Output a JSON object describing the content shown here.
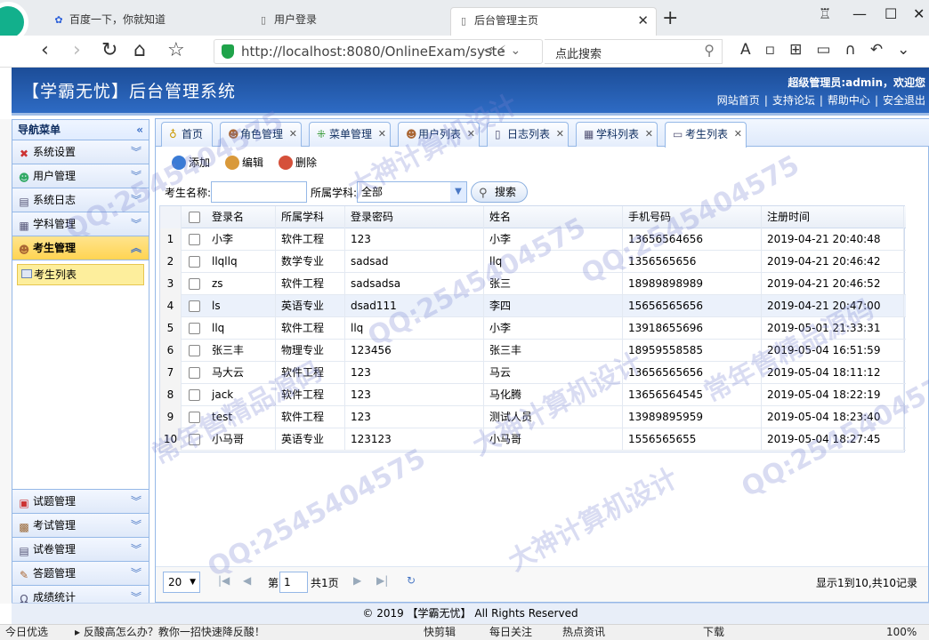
{
  "browser": {
    "tabs": [
      {
        "label": "百度一下，你就知道",
        "icon": "paw-icon"
      },
      {
        "label": "用户登录",
        "icon": "page-icon"
      },
      {
        "label": "后台管理主页",
        "icon": "page-icon",
        "active": true
      }
    ],
    "url": "http://localhost:8080/OnlineExam/syste",
    "search_placeholder": "点此搜索"
  },
  "header": {
    "title": "【学霸无忧】后台管理系统",
    "welcome": "超级管理员:admin，欢迎您",
    "links": [
      "网站首页",
      "支持论坛",
      "帮助中心",
      "安全退出"
    ]
  },
  "sidebar": {
    "title": "导航菜单",
    "items": [
      {
        "label": "系统设置",
        "icon": "tools-icon"
      },
      {
        "label": "用户管理",
        "icon": "users-icon"
      },
      {
        "label": "系统日志",
        "icon": "log-icon"
      },
      {
        "label": "学科管理",
        "icon": "list-icon"
      },
      {
        "label": "考生管理",
        "icon": "student-icon",
        "active": true
      }
    ],
    "sub_items": [
      {
        "label": "考生列表"
      }
    ],
    "bottom_items": [
      {
        "label": "试题管理",
        "icon": "calendar-icon"
      },
      {
        "label": "考试管理",
        "icon": "exam-icon"
      },
      {
        "label": "试卷管理",
        "icon": "paper-icon"
      },
      {
        "label": "答题管理",
        "icon": "answer-icon"
      },
      {
        "label": "成绩统计",
        "icon": "headset-icon"
      }
    ]
  },
  "tabs": [
    {
      "label": "首页",
      "icon": "bulb-icon",
      "closable": false
    },
    {
      "label": "角色管理",
      "closable": true
    },
    {
      "label": "菜单管理",
      "closable": true
    },
    {
      "label": "用户列表",
      "closable": true
    },
    {
      "label": "日志列表",
      "closable": true
    },
    {
      "label": "学科列表",
      "closable": true
    },
    {
      "label": "考生列表",
      "closable": true,
      "active": true
    }
  ],
  "toolbar": {
    "add": "添加",
    "edit": "编辑",
    "delete": "删除"
  },
  "filter": {
    "name_label": "考生名称:",
    "name_value": "",
    "subject_label": "所属学科:",
    "subject_value": "全部",
    "search_button": "搜索"
  },
  "grid": {
    "columns": [
      "登录名",
      "所属学科",
      "登录密码",
      "姓名",
      "手机号码",
      "注册时间"
    ],
    "rows": [
      [
        "小李",
        "软件工程",
        "123",
        "小李",
        "13656564656",
        "2019-04-21 20:40:48"
      ],
      [
        "llqllq",
        "数学专业",
        "sadsad",
        "llq",
        "1356565656",
        "2019-04-21 20:46:42"
      ],
      [
        "zs",
        "软件工程",
        "sadsadsa",
        "张三",
        "18989898989",
        "2019-04-21 20:46:52"
      ],
      [
        "ls",
        "英语专业",
        "dsad111",
        "李四",
        "15656565656",
        "2019-04-21 20:47:00"
      ],
      [
        "llq",
        "软件工程",
        "llq",
        "小李",
        "13918655696",
        "2019-05-01 21:33:31"
      ],
      [
        "张三丰",
        "物理专业",
        "123456",
        "张三丰",
        "18959558585",
        "2019-05-04 16:51:59"
      ],
      [
        "马大云",
        "软件工程",
        "123",
        "马云",
        "13656565656",
        "2019-05-04 18:11:12"
      ],
      [
        "jack",
        "软件工程",
        "123",
        "马化腾",
        "13656564545",
        "2019-05-04 18:22:19"
      ],
      [
        "test",
        "软件工程",
        "123",
        "测试人员",
        "13989895959",
        "2019-05-04 18:23:40"
      ],
      [
        "小马哥",
        "英语专业",
        "123123",
        "小马哥",
        "1556565655",
        "2019-05-04 18:27:45"
      ]
    ],
    "highlighted_row": 4
  },
  "pager": {
    "page_size": "20",
    "page_label": "第",
    "page_value": "1",
    "total_pages": "共1页",
    "info": "显示1到10,共10记录"
  },
  "footer": {
    "text": "© 2019 【学霸无忧】 All Rights Reserved"
  },
  "statusbar": {
    "left": "今日优选",
    "news": "反酸高怎么办？教你一招快速降反酸！",
    "items": [
      "快剪辑",
      "每日关注",
      "热点资讯",
      "下载",
      "100%"
    ]
  },
  "watermarks": [
    "QQ:2545404575",
    "大神计算机设计",
    "常年售精品源码"
  ],
  "colors": {
    "header_bg": "#2a5fb3",
    "active_menu": "#ffd452",
    "border": "#95b8e7"
  }
}
